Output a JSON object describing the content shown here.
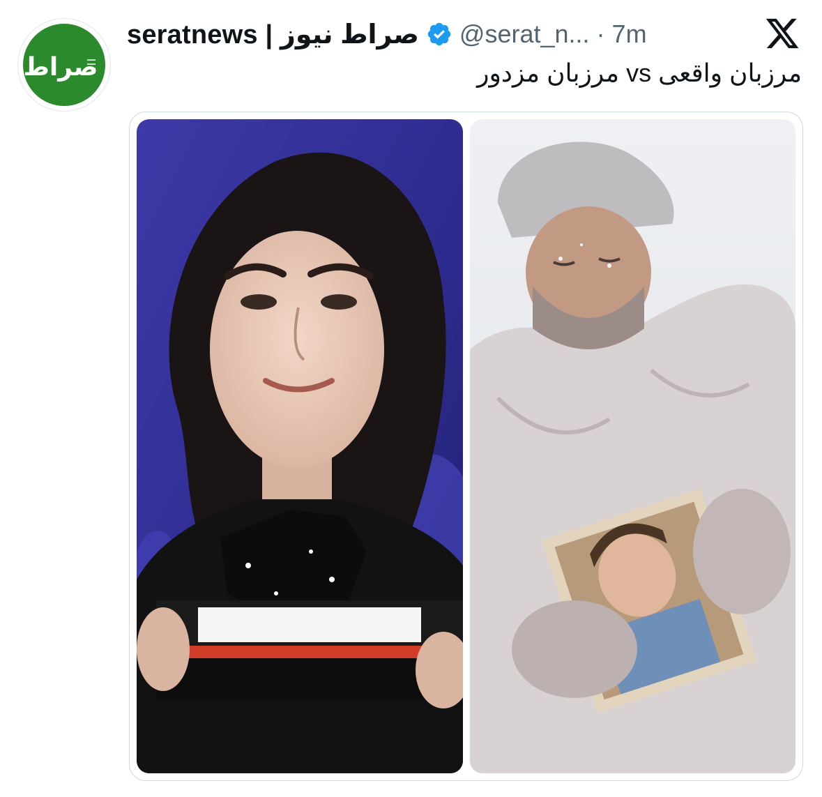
{
  "tweet": {
    "display_name": "seratnews | صراط نیوز",
    "handle_time": "@serat_n... · 7m",
    "text": "مرزبان واقعی vs مرزبان مزدور",
    "verified": true
  },
  "avatar": {
    "logo_text": "صراط",
    "bg_color": "#2b8a2b"
  },
  "colors": {
    "text_primary": "#0f1419",
    "text_secondary": "#536471",
    "verified_blue": "#1d9bf0",
    "border": "#cfd9de"
  },
  "icons": {
    "verified": "verified-badge-icon",
    "platform": "x-logo-icon"
  },
  "media": [
    {
      "description_name": "photo-left"
    },
    {
      "description_name": "photo-right"
    }
  ]
}
